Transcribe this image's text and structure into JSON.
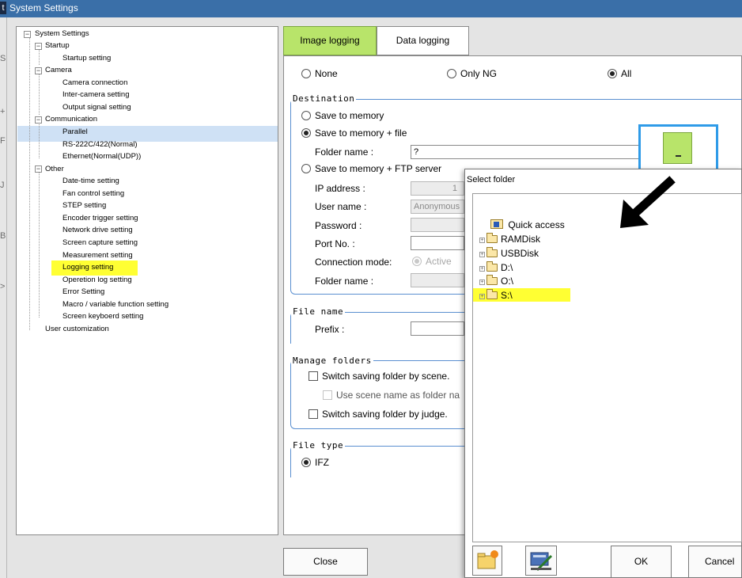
{
  "window": {
    "title": "System Settings"
  },
  "left_strip_glyphs": [
    "S",
    "+",
    "F",
    "J",
    "B",
    ">"
  ],
  "tree": {
    "items": [
      {
        "label": "System Settings"
      },
      {
        "label": "Startup"
      },
      {
        "label": "Startup setting"
      },
      {
        "label": "Camera"
      },
      {
        "label": "Camera connection"
      },
      {
        "label": "Inter-camera setting"
      },
      {
        "label": "Output signal setting"
      },
      {
        "label": "Communication"
      },
      {
        "label": "Parallel"
      },
      {
        "label": "RS-222C/422(Normal)"
      },
      {
        "label": "Ethernet(Normal(UDP))"
      },
      {
        "label": "Other"
      },
      {
        "label": "Date-time setting"
      },
      {
        "label": "Fan control setting"
      },
      {
        "label": "STEP setting"
      },
      {
        "label": "Encoder trigger setting"
      },
      {
        "label": "Network drive setting"
      },
      {
        "label": "Screen capture setting"
      },
      {
        "label": "Measurement setting"
      },
      {
        "label": "Logging setting"
      },
      {
        "label": "Operetion log setting"
      },
      {
        "label": "Error Setting"
      },
      {
        "label": "Macro / variable function setting"
      },
      {
        "label": "Screen keyboerd setting"
      },
      {
        "label": "User customization"
      }
    ]
  },
  "tabs": {
    "image": "Image logging",
    "data": "Data logging"
  },
  "logging_mode": {
    "none": "None",
    "only_ng": "Only NG",
    "all": "All",
    "selected": "All"
  },
  "destination": {
    "title": "Destination",
    "memory": "Save to memory",
    "memory_file": "Save to memory + file",
    "folder_label": "Folder name :",
    "folder_value": "?",
    "ftp": "Save to memory + FTP server",
    "ip_label": "IP address :",
    "ip_value": "1",
    "user_label": "User name :",
    "user_value": "Anonymous",
    "password_label": "Password :",
    "port_label": "Port No. :",
    "conn_label": "Connection mode:",
    "conn_value": "Active",
    "ftp_folder_label": "Folder name :",
    "selected": "Save to memory + file"
  },
  "file_name": {
    "title": "File name",
    "prefix_label": "Prefix :"
  },
  "manage_folders": {
    "title": "Manage folders",
    "by_scene": "Switch saving folder by scene.",
    "scene_name": "Use scene name as folder na",
    "by_judge": "Switch saving folder by judge."
  },
  "file_type": {
    "title": "File type",
    "ifz": "IFZ"
  },
  "close_button": "Close",
  "dialog": {
    "title": "Select folder",
    "items": [
      {
        "label": "Quick access"
      },
      {
        "label": "RAMDisk"
      },
      {
        "label": "USBDisk"
      },
      {
        "label": "D:\\"
      },
      {
        "label": "O:\\"
      },
      {
        "label": "S:\\"
      }
    ],
    "highlighted": "S:\\",
    "ok": "OK",
    "cancel": "Cancel"
  },
  "colors": {
    "tab_active": "#b8e46a",
    "highlight_yellow": "#ffff33",
    "selection_blue": "#cfe1f5",
    "group_border": "#5a8fd0",
    "annotation_box": "#2f9be8",
    "titlebar": "#3a6fa8"
  },
  "icons": {
    "browse": "ellipsis-icon",
    "new_folder": "new-folder-icon",
    "edit": "edit-icon",
    "arrow": "arrow-down-left-icon",
    "quick_access": "quick-access-icon"
  }
}
